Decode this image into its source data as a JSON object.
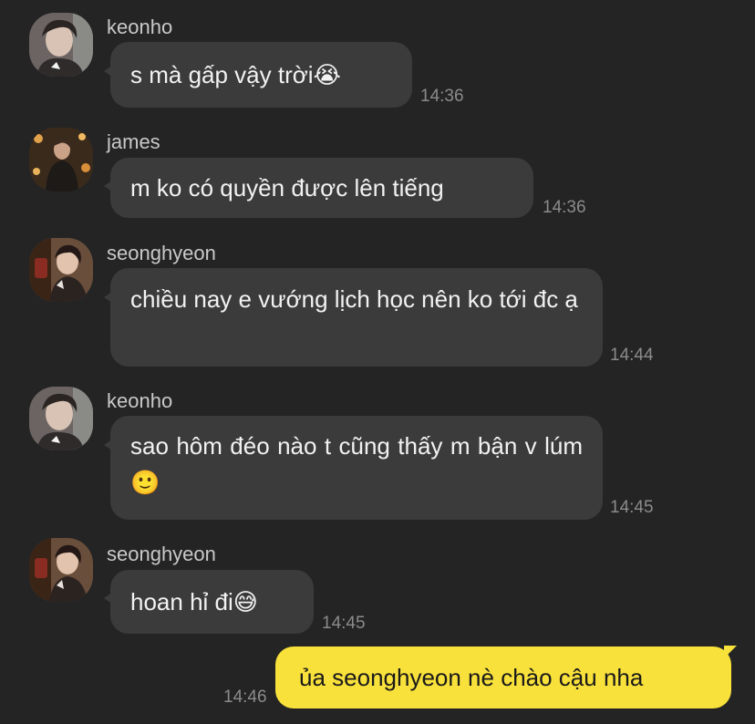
{
  "messages": [
    {
      "sender": "keonho",
      "text": "s mà gấp vậy trời😭",
      "time": "14:36"
    },
    {
      "sender": "james",
      "text": "m ko có quyền được lên tiếng",
      "time": "14:36"
    },
    {
      "sender": "seonghyeon",
      "text": "chiều nay e vướng lịch học nên ko tới đc ạ",
      "time": "14:44"
    },
    {
      "sender": "keonho",
      "text": "sao hôm đéo nào t cũng thấy m bận v lúm🙂",
      "time": "14:45"
    },
    {
      "sender": "seonghyeon",
      "text": "hoan hỉ đi😅",
      "time": "14:45"
    }
  ],
  "my_message": {
    "text": "ủa seonghyeon nè chào cậu nha",
    "time": "14:46"
  },
  "colors": {
    "background": "#242424",
    "incoming_bubble": "#3b3b3b",
    "outgoing_bubble": "#f9e13b"
  },
  "icons": [
    "avatar-keonho",
    "avatar-james",
    "avatar-seonghyeon"
  ]
}
